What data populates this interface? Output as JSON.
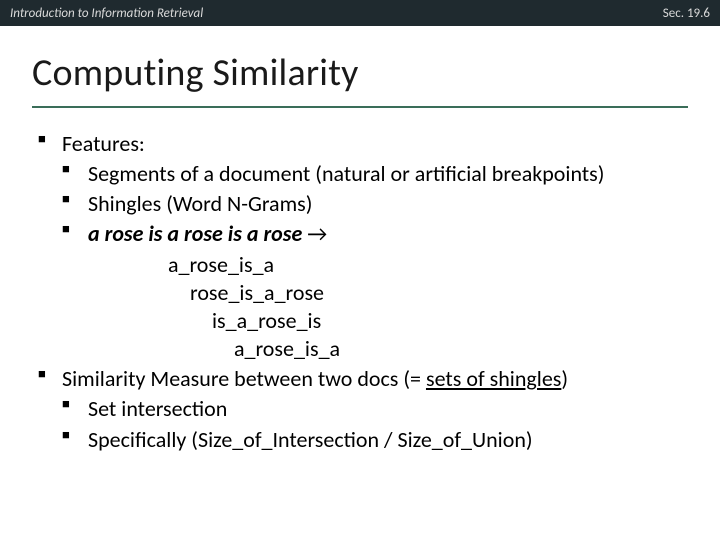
{
  "topbar": {
    "left": "Introduction to Information Retrieval",
    "right": "Sec. 19.6"
  },
  "title": "Computing Similarity",
  "body": {
    "features_label": "Features:",
    "feat1": "Segments of a document (natural or artificial breakpoints)",
    "feat2": "Shingles (Word N-Grams)",
    "feat3_ital": "a rose is a rose is a rose",
    "feat3_arrow": " →",
    "sh1": "a_rose_is_a",
    "sh2": "rose_is_a_rose",
    "sh3": "is_a_rose_is",
    "sh4": "a_rose_is_a",
    "sim_pre": "Similarity Measure between two docs (= ",
    "sim_under": "sets of shingles",
    "sim_post": ")",
    "sim1": "Set intersection",
    "sim2": "Specifically (Size_of_Intersection / Size_of_Union)"
  }
}
